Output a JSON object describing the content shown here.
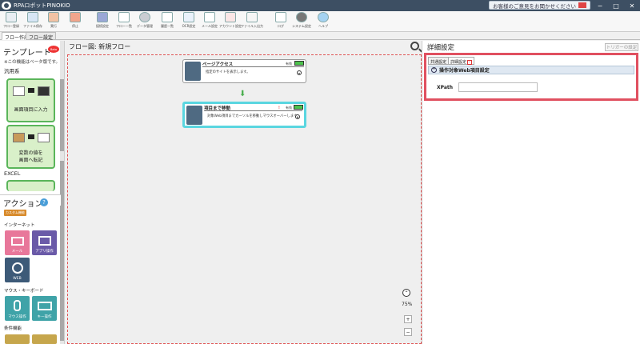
{
  "window": {
    "title": "RPAロボットPINOKIO",
    "feedback_label": "お客様のご意見をお聞かせください",
    "minimize": "−",
    "maximize": "□",
    "close": "✕"
  },
  "toolbar": {
    "items": [
      {
        "label": "フロー登録",
        "icon": "flow-register-icon"
      },
      {
        "label": "ファイル保存",
        "icon": "save-file-icon"
      },
      {
        "label": "実行",
        "icon": "run-icon"
      },
      {
        "label": "停止",
        "icon": "stop-icon"
      },
      {
        "label": "接続設定",
        "icon": "connect-icon"
      },
      {
        "label": "フロー一覧",
        "icon": "list-icon"
      },
      {
        "label": "データ管理",
        "icon": "database-icon"
      },
      {
        "label": "履歴一覧",
        "icon": "history-icon"
      },
      {
        "label": "OCR設定",
        "icon": "ocr-icon"
      },
      {
        "label": "メール設定",
        "icon": "mail-icon"
      },
      {
        "label": "アカウント設定",
        "icon": "account-icon"
      },
      {
        "label": "ファイル入出力",
        "icon": "file-io-icon"
      },
      {
        "label": "ログ",
        "icon": "log-icon"
      },
      {
        "label": "システム設定",
        "icon": "gear-icon"
      },
      {
        "label": "ヘルプ",
        "icon": "help-icon"
      }
    ]
  },
  "tabs": {
    "flow_create": "フロー作成",
    "flow_settings": "フロー設定"
  },
  "left": {
    "template_title": "テンプレート",
    "template_badge": "Beta",
    "beta_note": "※この機能はベータ版です。",
    "category_general": "汎用系",
    "template1_label": "画面項目に入力",
    "template2_label_1": "変数の値を",
    "template2_label_2": "画面へ転記",
    "category_excel": "EXCEL",
    "action_title": "アクション",
    "action_help": "?",
    "custom_tag": "カスタム機能",
    "internet_label": "インターネット",
    "mail_label": "メール",
    "app_label": "アプリ操作",
    "web_label": "WEB",
    "mouse_keyboard_label": "マウス・キーボード",
    "mouse_label": "マウス操作",
    "key_label": "キー操作",
    "condition_label": "条件機能"
  },
  "flow": {
    "header": "フロー図:  新規フロー",
    "node1": {
      "title": "ページアクセス",
      "desc": "指定のサイトを表示します。",
      "enabled": "有効"
    },
    "node2": {
      "title": "項目まで移動",
      "desc": "対象Web項目までカーソルを移動しマウスオーバーします。",
      "enabled": "有効",
      "warn": "!"
    },
    "zoom": "75%",
    "zoom_up": "⌃",
    "zoom_plus": "+",
    "zoom_minus": "−"
  },
  "right": {
    "title": "詳細設定",
    "trigger_button": "トリガーの設定",
    "tab_common": "共通設定",
    "tab_detail": "詳細設定",
    "tab_warn": "!",
    "section_title": "操作対象Web項目設定",
    "xpath_label": "XPath",
    "xpath_value": ""
  },
  "colors": {
    "highlight": "#e05060",
    "selected_node": "#5ad6e0",
    "template_bg": "#d9f0c9",
    "action_pink": "#e8779a",
    "action_purple": "#6a5aa8",
    "action_blue": "#3d5a78",
    "action_teal": "#3fa3a8"
  }
}
